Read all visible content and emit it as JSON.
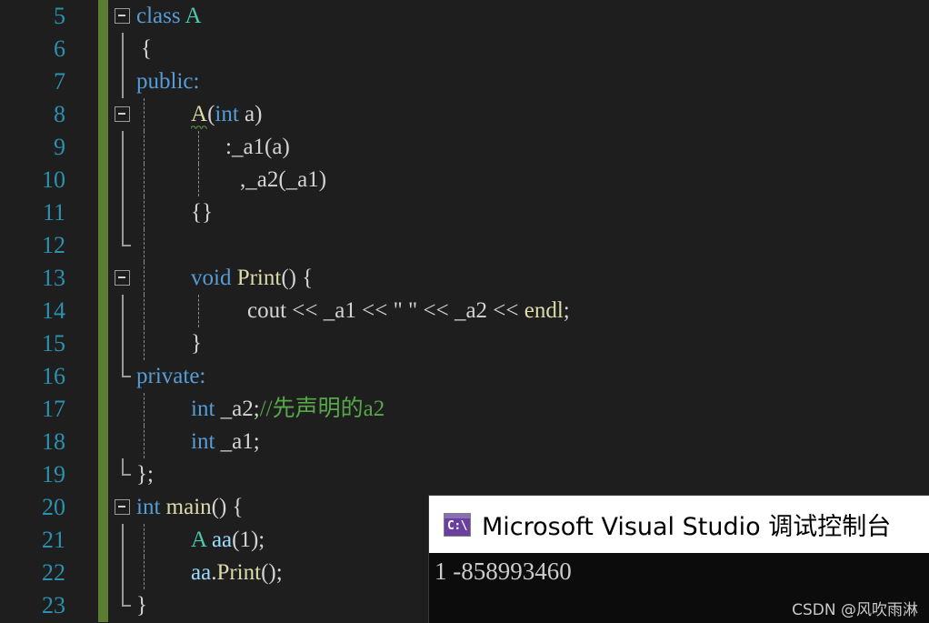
{
  "editor": {
    "background_color": "#1e1e1e",
    "line_number_color": "#2b91af",
    "change_bar_color": "#5a7d33",
    "first_line_number": 5,
    "lines": [
      {
        "number": "5",
        "fold": true,
        "text": "class A"
      },
      {
        "number": "6",
        "fold": false,
        "text": "{"
      },
      {
        "number": "7",
        "fold": false,
        "text": "public:"
      },
      {
        "number": "8",
        "fold": true,
        "text": "    A(int a)"
      },
      {
        "number": "9",
        "fold": false,
        "text": "        :_a1(a)"
      },
      {
        "number": "10",
        "fold": false,
        "text": "        ,_a2(_a1)"
      },
      {
        "number": "11",
        "fold": false,
        "text": "    {}"
      },
      {
        "number": "12",
        "fold": false,
        "text": ""
      },
      {
        "number": "13",
        "fold": true,
        "text": "    void Print() {"
      },
      {
        "number": "14",
        "fold": false,
        "text": "        cout << _a1 << \" \" << _a2 << endl;"
      },
      {
        "number": "15",
        "fold": false,
        "text": "    }"
      },
      {
        "number": "16",
        "fold": false,
        "text": "private:"
      },
      {
        "number": "17",
        "fold": false,
        "text": "    int _a2;//先声明的a2"
      },
      {
        "number": "18",
        "fold": false,
        "text": "    int _a1;"
      },
      {
        "number": "19",
        "fold": false,
        "text": "};"
      },
      {
        "number": "20",
        "fold": true,
        "text": "int main() {"
      },
      {
        "number": "21",
        "fold": false,
        "text": "    A aa(1);"
      },
      {
        "number": "22",
        "fold": false,
        "text": "    aa.Print();"
      },
      {
        "number": "23",
        "fold": false,
        "text": "}"
      }
    ],
    "tokens": {
      "l5_kw": "class",
      "l5_type": "A",
      "l6_brace": "{",
      "l7_kw": "public:",
      "l8_type": "A",
      "l8_p1": "(",
      "l8_kw": "int",
      "l8_ident": "a",
      "l8_p2": ")",
      "l9_text": ":_a1(a)",
      "l10_text": ",_a2(_a1)",
      "l11_text": "{}",
      "l13_kw": "void",
      "l13_fn": "Print",
      "l13_p": "() {",
      "l14_ident1": "cout",
      "l14_op1": " << ",
      "l14_ident2": "_a1",
      "l14_op2": " << ",
      "l14_str": "\" \"",
      "l14_op3": " << ",
      "l14_ident3": "_a2",
      "l14_op4": " << ",
      "l14_endl": "endl",
      "l14_semi": ";",
      "l15_brace": "}",
      "l16_kw": "private:",
      "l17_kw": "int",
      "l17_ident": " _a2;",
      "l17_comment": "//先声明的a2",
      "l18_kw": "int",
      "l18_ident": " _a1;",
      "l19_text": "};",
      "l20_kw": "int",
      "l20_fn": " main",
      "l20_p": "() {",
      "l21_type": "A",
      "l21_ident": " aa",
      "l21_p1": "(",
      "l21_num": "1",
      "l21_p2": ");",
      "l22_ident": "aa",
      "l22_dot": ".",
      "l22_fn": "Print",
      "l22_p": "();",
      "l23_brace": "}"
    }
  },
  "console": {
    "icon": "console-cmd-icon",
    "icon_glyph": "C:\\",
    "title": "Microsoft Visual Studio 调试控制台",
    "output": "1 -858993460",
    "title_bar_color": "#ffffff",
    "body_color": "#0c0c0c"
  },
  "watermark": {
    "text": "CSDN @风吹雨淋"
  }
}
